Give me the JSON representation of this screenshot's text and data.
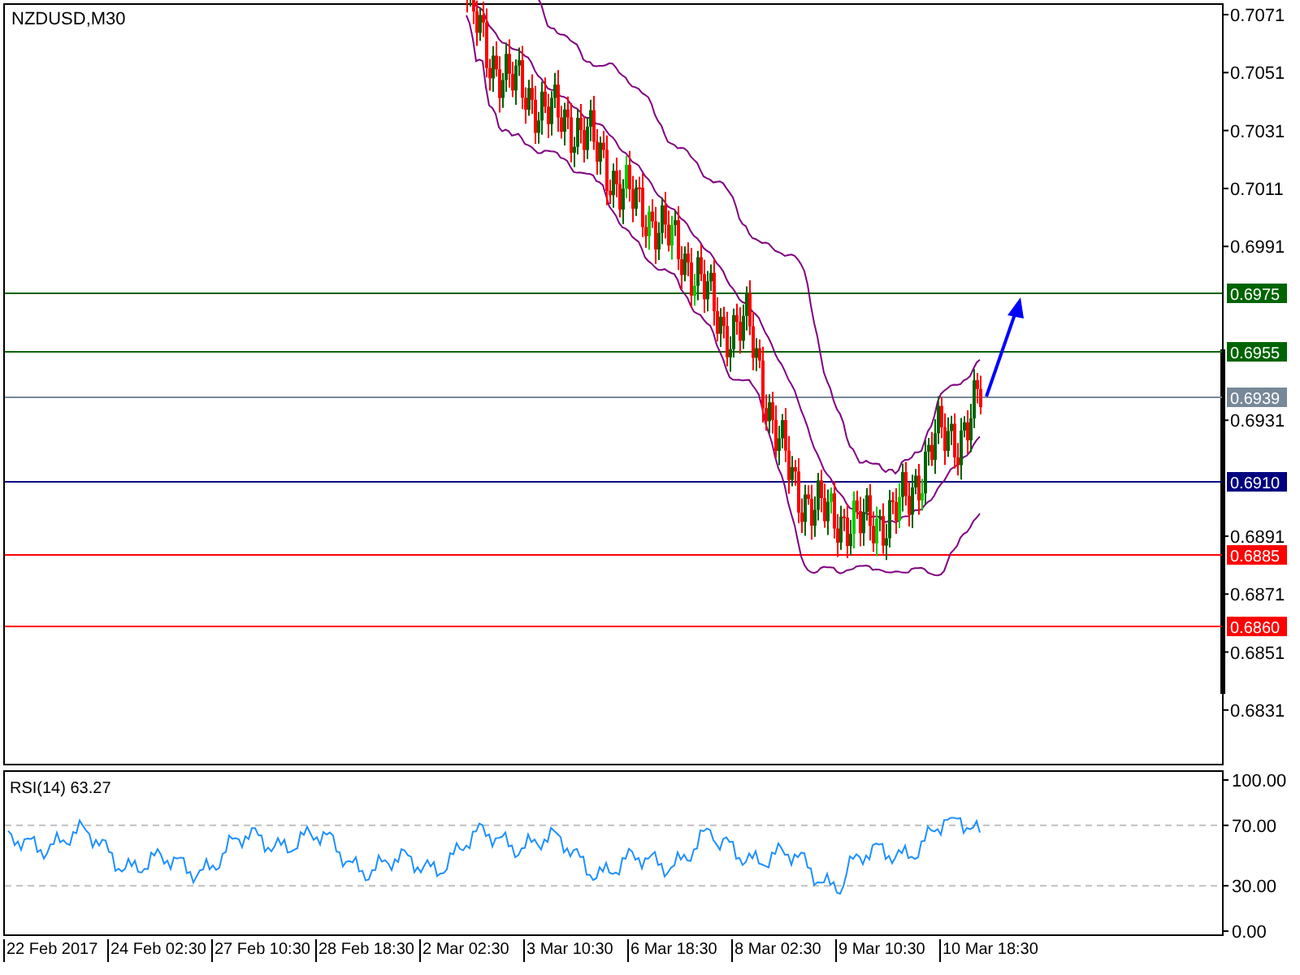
{
  "chart": {
    "title": "NZDUSD,M30",
    "price_ticks": [
      "0.7071",
      "0.7051",
      "0.7031",
      "0.7011",
      "0.6991",
      "0.6931",
      "0.6891",
      "0.6871",
      "0.6851",
      "0.6831"
    ],
    "levels": [
      {
        "price": "0.6975",
        "color": "#006400"
      },
      {
        "price": "0.6955",
        "color": "#006400"
      },
      {
        "price": "0.6939",
        "color": "#778899"
      },
      {
        "price": "0.6910",
        "color": "#000080"
      },
      {
        "price": "0.6885",
        "color": "#ff0000"
      },
      {
        "price": "0.6860",
        "color": "#ff0000"
      }
    ]
  },
  "rsi": {
    "title": "RSI(14) 63.27",
    "ticks": [
      "100.00",
      "70.00",
      "30.00",
      "0.00"
    ]
  },
  "time_axis": [
    "22 Feb 2017",
    "24 Feb 02:30",
    "27 Feb 10:30",
    "28 Feb 18:30",
    "2 Mar 02:30",
    "3 Mar 10:30",
    "6 Mar 18:30",
    "8 Mar 02:30",
    "9 Mar 10:30",
    "10 Mar 18:30"
  ]
}
